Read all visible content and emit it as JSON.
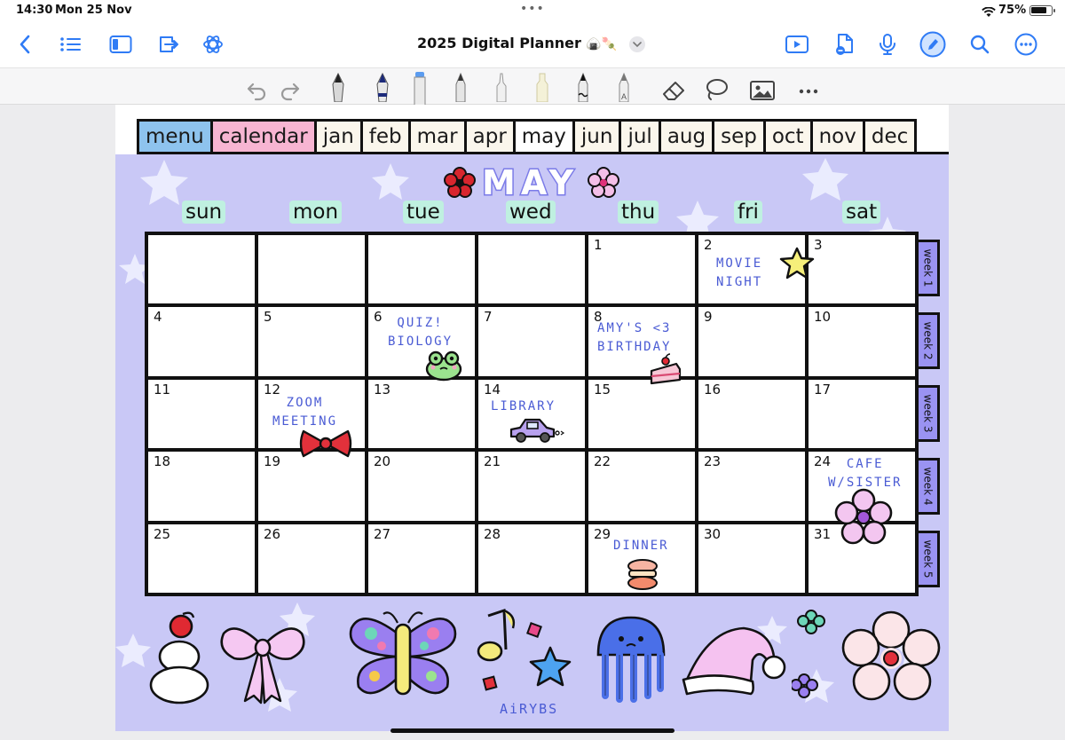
{
  "status_bar": {
    "time": "14:30",
    "date": "Mon 25 Nov",
    "battery_pct": "75%"
  },
  "nav": {
    "title": "2025 Digital Planner",
    "title_emoji": "🍙🍡"
  },
  "planner": {
    "tabs": [
      "menu",
      "calendar",
      "jan",
      "feb",
      "mar",
      "apr",
      "may",
      "jun",
      "jul",
      "aug",
      "sep",
      "oct",
      "nov",
      "dec"
    ],
    "active_tab": "may",
    "month": "may",
    "weekdays": [
      "sun",
      "mon",
      "tue",
      "wed",
      "thu",
      "fri",
      "sat"
    ],
    "days": [
      [
        "",
        "",
        "",
        "",
        "1",
        "2",
        "3"
      ],
      [
        "4",
        "5",
        "6",
        "7",
        "8",
        "9",
        "10"
      ],
      [
        "11",
        "12",
        "13",
        "14",
        "15",
        "16",
        "17"
      ],
      [
        "18",
        "19",
        "20",
        "21",
        "22",
        "23",
        "24"
      ],
      [
        "25",
        "26",
        "27",
        "28",
        "29",
        "30",
        "31"
      ]
    ],
    "notes": {
      "movie": "MOVIE\nNIGHT",
      "quiz": "QUIZ!\nBIOLOGY",
      "amy": "AMY'S <3\nBIRTHDAY",
      "zoom": "ZOOM\nMEETING",
      "library": "LIBRARY",
      "cafe": "CAFE\nW/SISTER",
      "dinner": "DINNER"
    },
    "week_tabs": [
      "week 1",
      "week 2",
      "week 3",
      "week 4",
      "week 5"
    ],
    "signature": "AiRYBS"
  },
  "colors": {
    "accent": "#2f7bf5",
    "page_bg": "#c9c8f6",
    "note_ink": "#4a5bd4",
    "weekday_bg": "#bff0e0",
    "menu_tab": "#8ec3ee",
    "calendar_tab": "#f7b5d2"
  },
  "icons": {
    "nav": [
      "back-chevron-icon",
      "list-icon",
      "sidebar-icon",
      "export-icon",
      "ai-swirl-icon",
      "present-icon",
      "document-add-icon",
      "microphone-icon",
      "pencil-circle-icon",
      "search-icon",
      "more-icon"
    ],
    "tools": [
      "undo-icon",
      "redo-icon",
      "fountain-pen-icon",
      "ink-pen-icon",
      "marker-icon",
      "pencil-icon",
      "fineliner-icon",
      "highlighter-icon",
      "brush-pen-icon",
      "monoline-pen-icon",
      "eraser-icon",
      "lasso-icon",
      "image-icon",
      "more-icon"
    ]
  }
}
